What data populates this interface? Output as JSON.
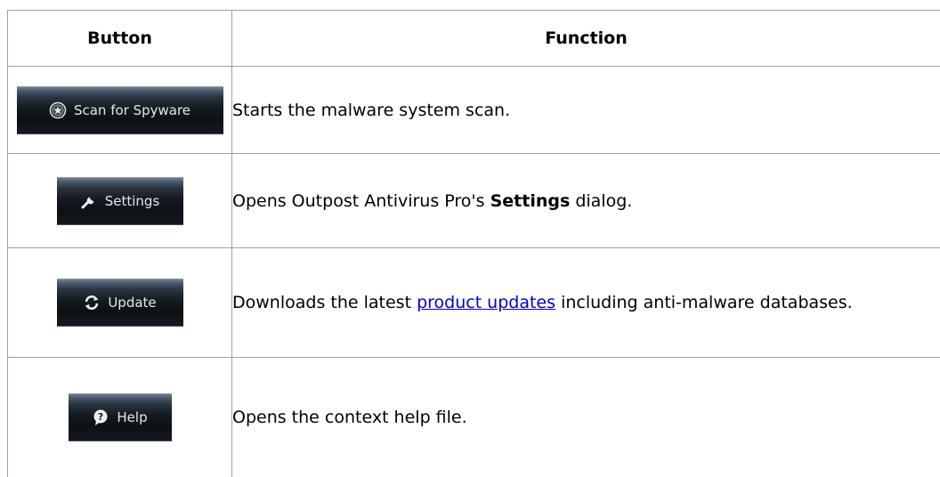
{
  "table": {
    "headers": {
      "button": "Button",
      "function": "Function"
    },
    "rows": [
      {
        "button_label": "Scan for Spyware",
        "button_icon": "shield-star-icon",
        "description_before": "Starts the malware system scan.",
        "description_bold": "",
        "link_text": "",
        "description_after": ""
      },
      {
        "button_label": "Settings",
        "button_icon": "wrench-icon",
        "description_before": "Opens Outpost Antivirus Pro's ",
        "description_bold": "Settings",
        "link_text": "",
        "description_after": " dialog."
      },
      {
        "button_label": "Update",
        "button_icon": "refresh-icon",
        "description_before": "Downloads the latest ",
        "description_bold": "",
        "link_text": "product updates",
        "description_after": " including anti-malware databases."
      },
      {
        "button_label": "Help",
        "button_icon": "help-icon",
        "description_before": "Opens the context help file.",
        "description_bold": "",
        "link_text": "",
        "description_after": ""
      }
    ]
  },
  "colors": {
    "border": "#a0a0a0",
    "link": "#0000cc",
    "button_text": "#e6e6e6"
  }
}
